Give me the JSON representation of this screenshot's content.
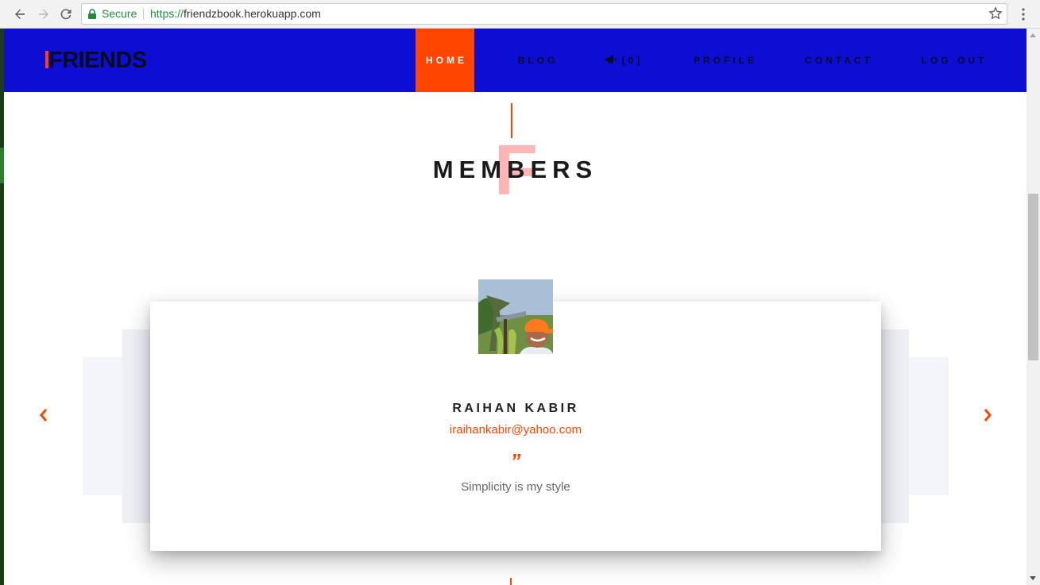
{
  "browser": {
    "secure_label": "Secure",
    "url_scheme": "https://",
    "url_rest": "friendzbook.herokuapp.com"
  },
  "site": {
    "logo": "FRIENDS",
    "nav": [
      {
        "label": "HOME",
        "active": true
      },
      {
        "label": "BLOG",
        "active": false
      },
      {
        "label": "[0]",
        "active": false,
        "icon": "megaphone-icon"
      },
      {
        "label": "PROFILE",
        "active": false
      },
      {
        "label": "CONTACT",
        "active": false
      },
      {
        "label": "LOG OUT",
        "active": false
      }
    ]
  },
  "section": {
    "title": "MEMBERS",
    "decor_letter": "F"
  },
  "member": {
    "name": "RAIHAN KABIR",
    "email": "iraihankabir@yahoo.com",
    "quote_mark": "”",
    "quote": "Simplicity is my style"
  },
  "colors": {
    "navbar": "#0c0fd3",
    "accent": "#ff4500",
    "secure_green": "#1e8e3e"
  }
}
